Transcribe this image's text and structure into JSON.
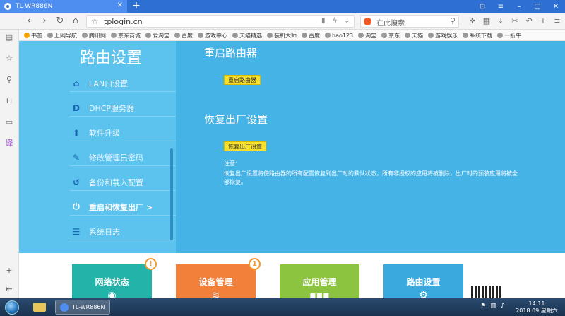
{
  "browser": {
    "tab_title": "TL-WR886N",
    "new_tab": "+",
    "url": "tplogin.cn",
    "search_placeholder": "在此搜索",
    "bookmarks": [
      "书签",
      "上网导航",
      "腾讯网",
      "京东商城",
      "爱淘宝",
      "百度",
      "游戏中心",
      "天猫精选",
      "装机大师",
      "百度",
      "hao123",
      "淘宝",
      "京东",
      "天猫",
      "游戏娱乐",
      "系统下载",
      "一折牛"
    ]
  },
  "sidebar": {
    "title": "路由设置",
    "items": [
      {
        "label": "LAN口设置",
        "icon": "house-icon"
      },
      {
        "label": "DHCP服务器",
        "icon": "dhcp-icon"
      },
      {
        "label": "软件升级",
        "icon": "upload-arrow-icon"
      },
      {
        "label": "修改管理员密码",
        "icon": "pencil-icon"
      },
      {
        "label": "备份和载入配置",
        "icon": "history-icon"
      },
      {
        "label": "重启和恢复出厂 >",
        "icon": "power-icon",
        "active": true
      },
      {
        "label": "系统日志",
        "icon": "list-icon"
      }
    ]
  },
  "main": {
    "reboot_title": "重启路由器",
    "reboot_button": "重启路由器",
    "factory_title": "恢复出厂设置",
    "factory_button": "恢复出厂设置",
    "note_label": "注意：",
    "note_text": "恢复出厂设置将使路由器的所有配置恢复到出厂时的默认状态，所有非授权的应用将被删除，出厂时的预装应用将被全部恢复。"
  },
  "cards": [
    {
      "label": "网络状态",
      "color": "#23b3a8",
      "badge": "!"
    },
    {
      "label": "设备管理",
      "color": "#f2803a",
      "badge": "1"
    },
    {
      "label": "应用管理",
      "color": "#8cc43f",
      "badge": ""
    },
    {
      "label": "路由设置",
      "color": "#3aa9dd",
      "badge": ""
    }
  ],
  "taskbar": {
    "task_title": "TL-WR886N",
    "time": "14:11",
    "date": "2018.09.星期六"
  },
  "colors": {
    "panel": "#45b3e5",
    "sidebar": "#5cc2ee",
    "button_yellow": "#f7e02c",
    "tab_bar": "#2d6fd2"
  }
}
